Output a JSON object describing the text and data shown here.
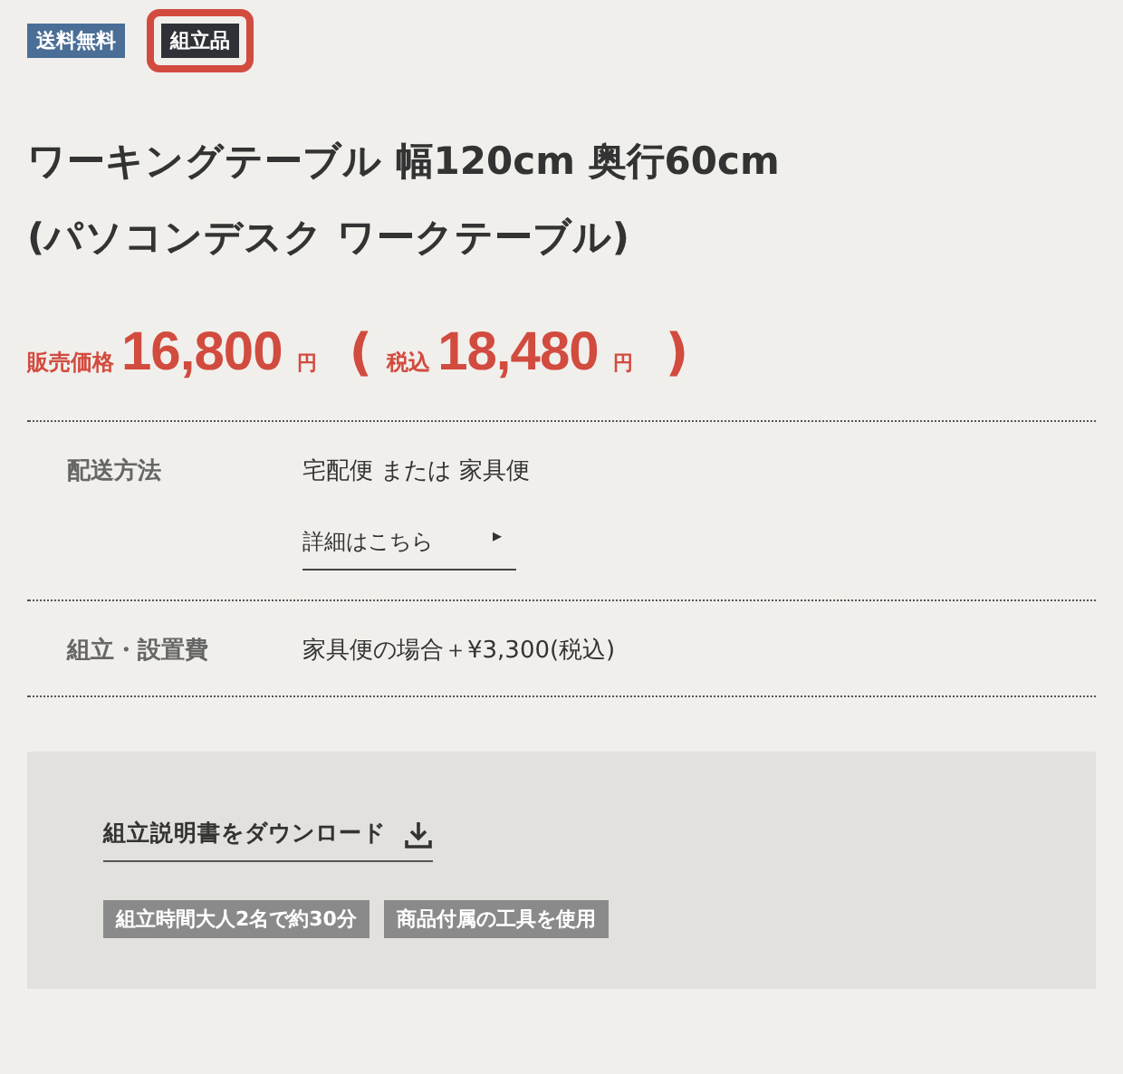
{
  "badges": [
    {
      "label": "送料無料",
      "kind": "shipping",
      "highlighted": false
    },
    {
      "label": "組立品",
      "kind": "assembly",
      "highlighted": true
    }
  ],
  "title": [
    "ワーキングテーブル 幅120cm 奥行60cm",
    "(パソコンデスク ワークテーブル)"
  ],
  "price": {
    "label": "販売価格",
    "amount": "16,800",
    "unit": "円",
    "open": "(",
    "tax_label": "税込",
    "tax_amount": "18,480",
    "tax_unit": "円",
    "close": ")"
  },
  "specs": [
    {
      "label": "配送方法",
      "value": "宅配便 または 家具便",
      "link": {
        "text": "詳細はこちら",
        "arrow": "▸"
      }
    },
    {
      "label": "組立・設置費",
      "value": "家具便の場合＋¥3,300(税込)"
    }
  ],
  "assembly": {
    "download": "組立説明書をダウンロード",
    "chips": [
      "組立時間大人2名で約30分",
      "商品付属の工具を使用"
    ]
  }
}
